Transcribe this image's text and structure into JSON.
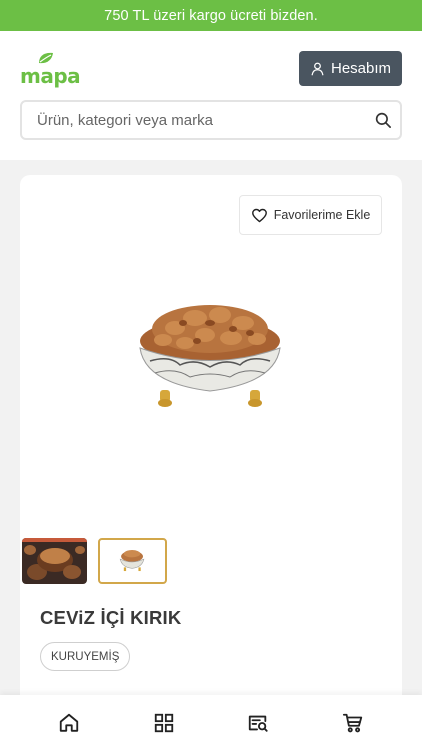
{
  "promo": {
    "text": "750 TL üzeri kargo ücreti bizden."
  },
  "header": {
    "logo_text": "mapa",
    "account_label": "Hesabım",
    "search_placeholder": "Ürün, kategori veya marka"
  },
  "product": {
    "favorite_label": "Favorilerime Ekle",
    "title": "CEViZ İÇİ KIRIK",
    "tag": "KURUYEMİŞ",
    "selected_thumbnail": 2
  },
  "bottom_nav": {
    "items": [
      "home-icon",
      "grid-icon",
      "search-list-icon",
      "cart-icon"
    ]
  },
  "colors": {
    "brand": "#6cbf45",
    "account_button": "#4a5560",
    "thumb_border": "#d2a74a"
  }
}
